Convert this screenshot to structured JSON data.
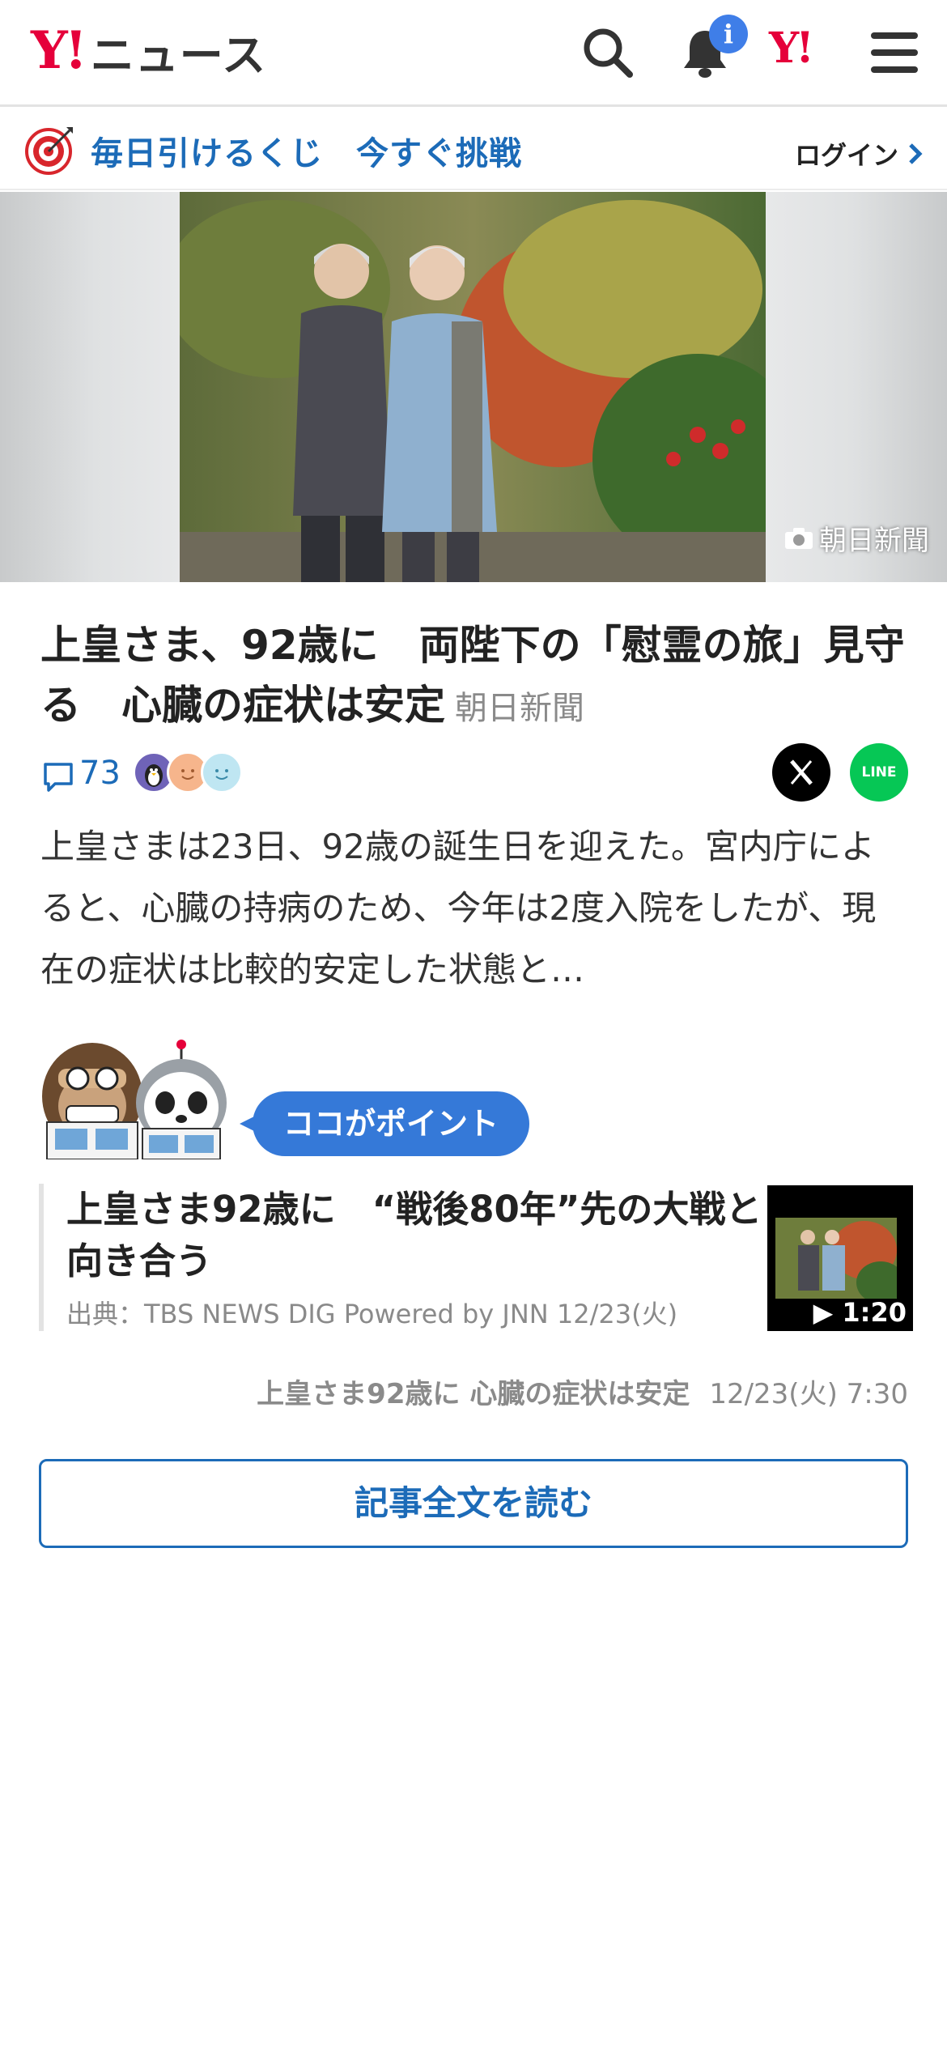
{
  "header": {
    "logo_y": "Y!",
    "logo_text": "ニュース",
    "notification_badge": "i",
    "yahoo_link": "Y!"
  },
  "promo": {
    "text": "毎日引けるくじ　今すぐ挑戦",
    "login_label": "ログイン"
  },
  "hero": {
    "photo_credit": "朝日新聞"
  },
  "article": {
    "title": "上皇さま、92歳に　両陛下の「慰霊の旅」見守る　心臓の症状は安定",
    "source": "朝日新聞",
    "comment_count": "73",
    "share_x_label": "X",
    "share_line_label": "LINE",
    "lead": "上皇さまは23日、92歳の誕生日を迎えた。宮内庁によると、心臓の持病のため、今年は2度入院をしたが、現在の症状は比較的安定した状態と…"
  },
  "point": {
    "badge": "ココがポイント"
  },
  "related": {
    "title": "上皇さま92歳に　“戦後80年”先の大戦と向き合う",
    "source": "出典：TBS NEWS DIG Powered by JNN 12/23(火)",
    "video_duration": "▶ 1:20"
  },
  "related_footer": {
    "title": "上皇さま92歳に 心臓の症状は安定",
    "datetime": "12/23(火) 7:30"
  },
  "read_more_label": "記事全文を読む",
  "colors": {
    "brand_red": "#e5003a",
    "link_blue": "#1c6bb8",
    "badge_blue": "#3579d8",
    "line_green": "#06c755"
  }
}
